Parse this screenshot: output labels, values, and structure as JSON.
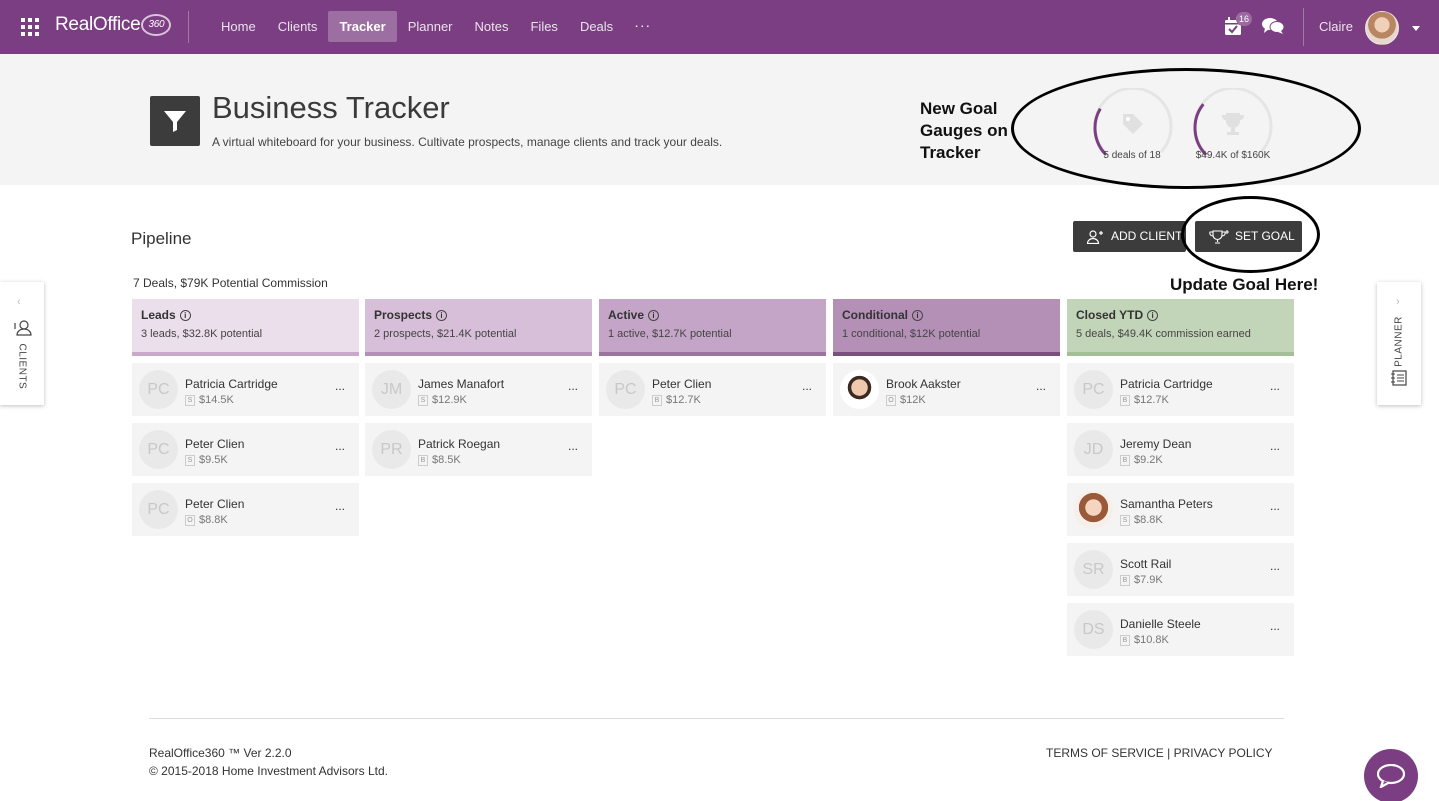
{
  "app": {
    "logo_text": "RealOffice",
    "logo_badge": "360",
    "nav": [
      {
        "label": "Home",
        "active": false
      },
      {
        "label": "Clients",
        "active": false
      },
      {
        "label": "Tracker",
        "active": true
      },
      {
        "label": "Planner",
        "active": false
      },
      {
        "label": "Notes",
        "active": false
      },
      {
        "label": "Files",
        "active": false
      },
      {
        "label": "Deals",
        "active": false
      }
    ],
    "more_label": "···",
    "notification_count": "16",
    "username": "Claire"
  },
  "header": {
    "title": "Business Tracker",
    "subtitle": "A virtual whiteboard for your business. Cultivate prospects, manage clients and track your deals.",
    "annotation": "New Goal Gauges on Tracker",
    "gauges": [
      {
        "label": "5 deals of 18",
        "icon": "tag-icon",
        "progress": 0.28
      },
      {
        "label": "$49.4K of $160K",
        "icon": "trophy-icon",
        "progress": 0.31
      }
    ],
    "accent_color": "#7b3e82"
  },
  "pipeline": {
    "title": "Pipeline",
    "summary": "7 Deals, $79K Potential Commission",
    "add_client_label": "ADD CLIENT",
    "set_goal_label": "SET GOAL",
    "goal_annotation": "Update Goal Here!",
    "columns": [
      {
        "name": "Leads",
        "sub": "3 leads, $32.8K potential",
        "bg": "#ecdfec",
        "bar": "#c9a8cc",
        "cards": [
          {
            "initials": "PC",
            "name": "Patricia Cartridge",
            "tag": "S",
            "value": "$14.5K"
          },
          {
            "initials": "PC",
            "name": "Peter Clien",
            "tag": "S",
            "value": "$9.5K"
          },
          {
            "initials": "PC",
            "name": "Peter Clien",
            "tag": "O",
            "value": "$8.8K"
          }
        ]
      },
      {
        "name": "Prospects",
        "sub": "2 prospects, $21.4K potential",
        "bg": "#d8bfd9",
        "bar": "#b48fb7",
        "cards": [
          {
            "initials": "JM",
            "name": "James Manafort",
            "tag": "S",
            "value": "$12.9K"
          },
          {
            "initials": "PR",
            "name": "Patrick Roegan",
            "tag": "B",
            "value": "$8.5K"
          }
        ]
      },
      {
        "name": "Active",
        "sub": "1 active, $12.7K potential",
        "bg": "#c5a5c7",
        "bar": "#9c74a0",
        "cards": [
          {
            "initials": "PC",
            "name": "Peter Clien",
            "tag": "B",
            "value": "$12.7K"
          }
        ]
      },
      {
        "name": "Conditional",
        "sub": "1 conditional, $12K potential",
        "bg": "#b490b7",
        "bar": "#7b4e80",
        "cards": [
          {
            "initials": "",
            "name": "Brook Aakster",
            "tag": "O",
            "value": "$12K",
            "photo": "m"
          }
        ]
      },
      {
        "name": "Closed YTD",
        "sub": "5 deals, $49.4K commission earned",
        "bg": "#c3d5b9",
        "bar": "#a3bf95",
        "cards": [
          {
            "initials": "PC",
            "name": "Patricia Cartridge",
            "tag": "B",
            "value": "$12.7K"
          },
          {
            "initials": "JD",
            "name": "Jeremy Dean",
            "tag": "B",
            "value": "$9.2K"
          },
          {
            "initials": "",
            "name": "Samantha Peters",
            "tag": "S",
            "value": "$8.8K",
            "photo": "f"
          },
          {
            "initials": "SR",
            "name": "Scott Rail",
            "tag": "B",
            "value": "$7.9K"
          },
          {
            "initials": "DS",
            "name": "Danielle Steele",
            "tag": "B",
            "value": "$10.8K"
          }
        ]
      }
    ],
    "card_more": "..."
  },
  "side": {
    "clients_label": "CLIENTS",
    "planner_label": "PLANNER"
  },
  "footer": {
    "version": "RealOffice360 ™ Ver 2.2.0",
    "copyright": "© 2015-2018 Home Investment Advisors Ltd.",
    "links": "TERMS OF SERVICE | PRIVACY POLICY"
  }
}
